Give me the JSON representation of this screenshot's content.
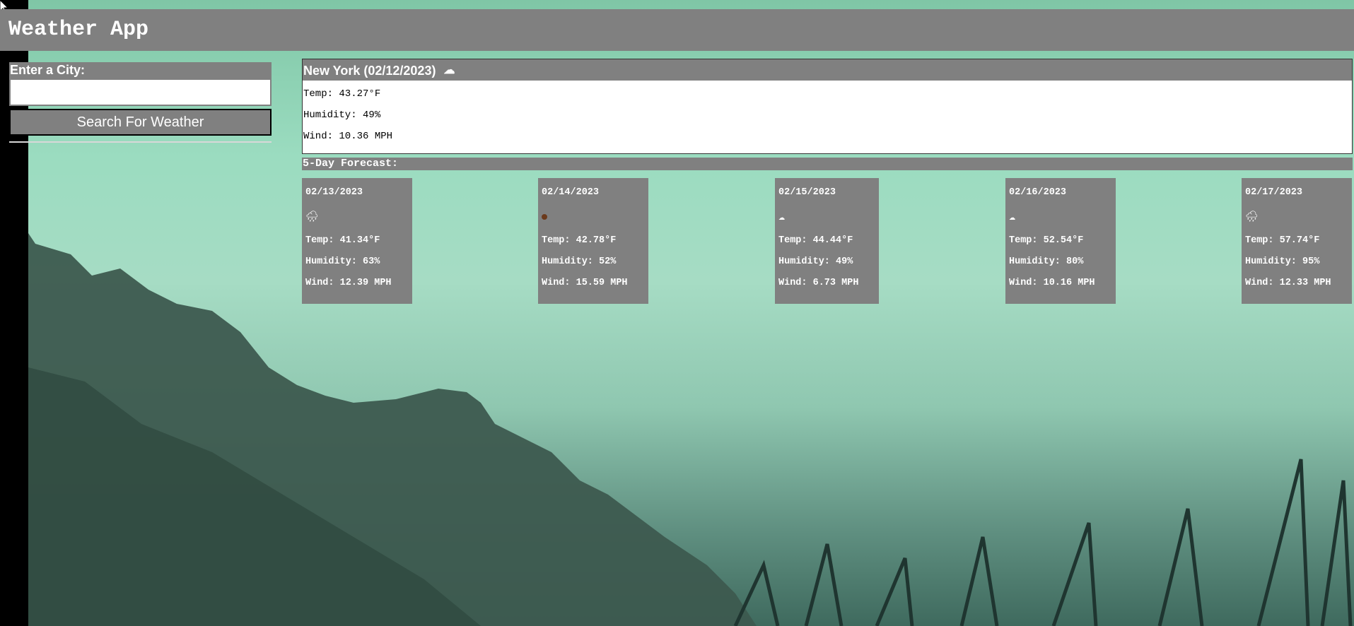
{
  "header": {
    "title": "Weather App"
  },
  "search": {
    "label": "Enter a City:",
    "input_value": "",
    "button_label": "Search For Weather"
  },
  "current": {
    "title": "New York (02/12/2023)",
    "icon": "cloud-icon",
    "temp": "Temp: 43.27°F",
    "humidity": "Humidity: 49%",
    "wind": "Wind: 10.36 MPH"
  },
  "forecast": {
    "heading": "5-Day Forecast:",
    "days": [
      {
        "date": "02/13/2023",
        "icon": "rain-cloud-icon",
        "temp": "Temp: 41.34°F",
        "humidity": "Humidity: 63%",
        "wind": "Wind: 12.39 MPH"
      },
      {
        "date": "02/14/2023",
        "icon": "small-dot-icon",
        "temp": "Temp: 42.78°F",
        "humidity": "Humidity: 52%",
        "wind": "Wind: 15.59 MPH"
      },
      {
        "date": "02/15/2023",
        "icon": "cloud-icon",
        "temp": "Temp: 44.44°F",
        "humidity": "Humidity: 49%",
        "wind": "Wind: 6.73 MPH"
      },
      {
        "date": "02/16/2023",
        "icon": "cloud-icon",
        "temp": "Temp: 52.54°F",
        "humidity": "Humidity: 80%",
        "wind": "Wind: 10.16 MPH"
      },
      {
        "date": "02/17/2023",
        "icon": "rain-cloud-icon",
        "temp": "Temp: 57.74°F",
        "humidity": "Humidity: 95%",
        "wind": "Wind: 12.33 MPH"
      }
    ]
  }
}
